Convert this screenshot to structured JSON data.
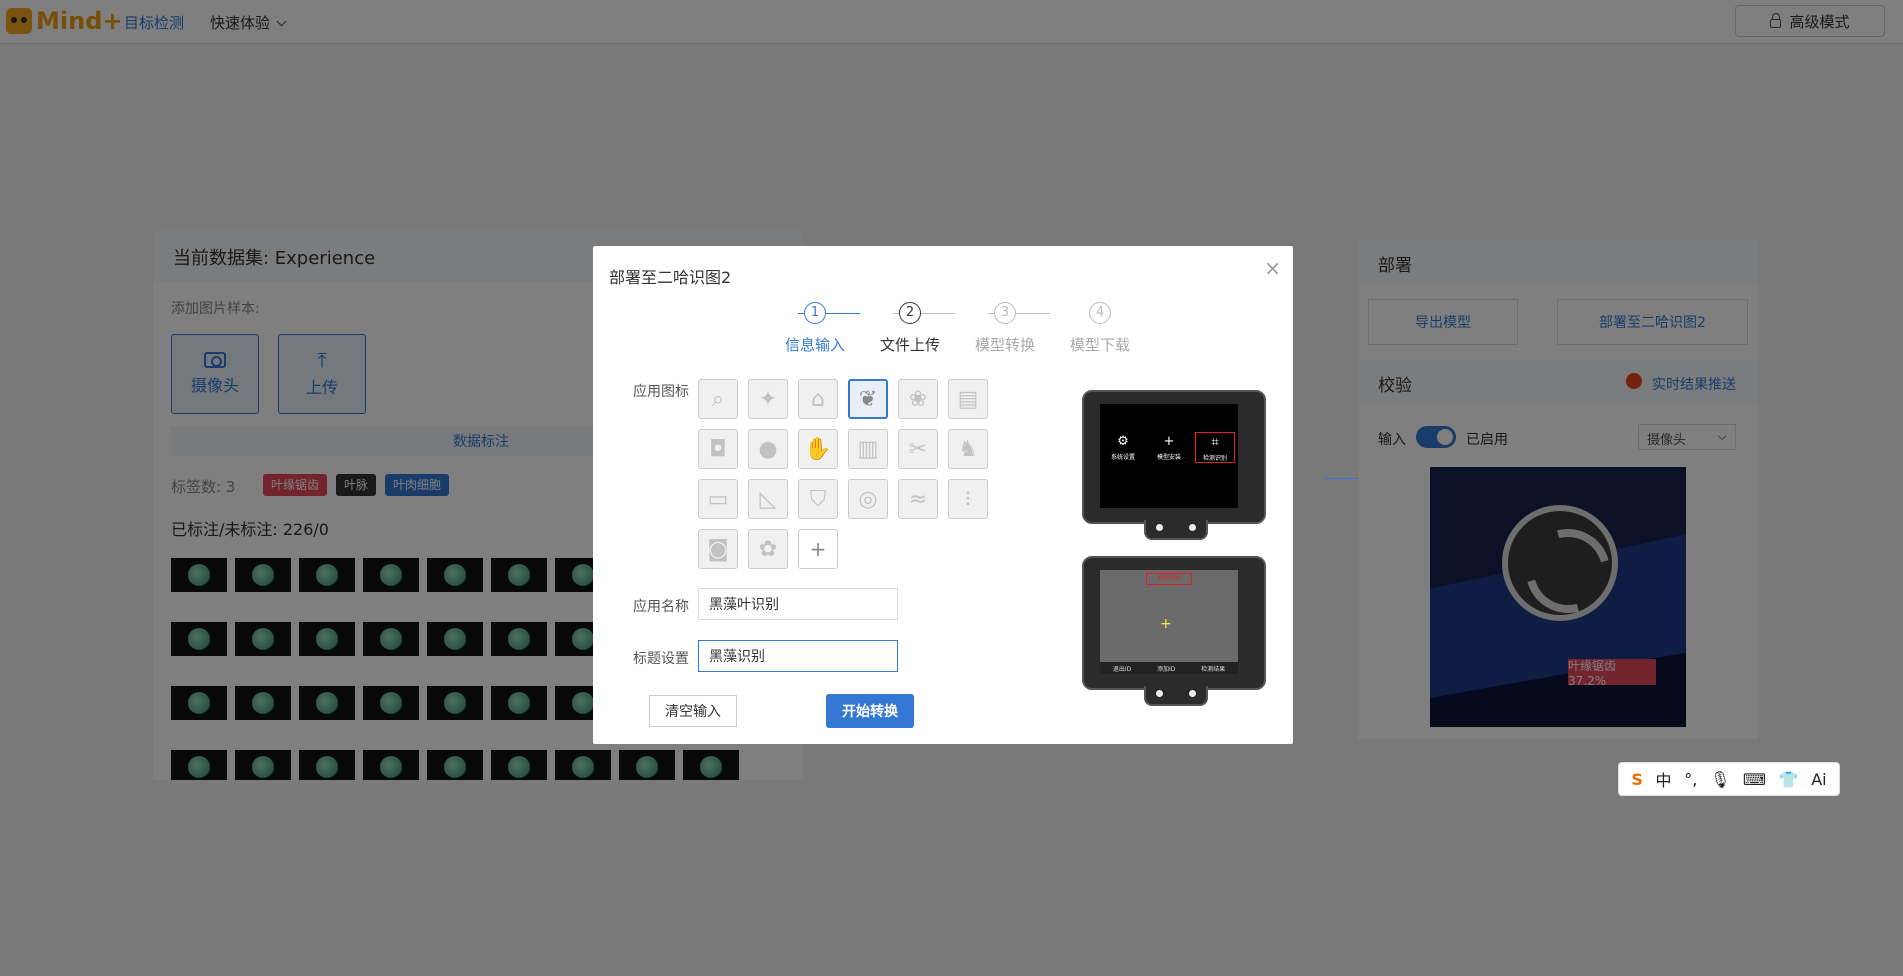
{
  "topbar": {
    "logo": "Mind+",
    "nav_detect": "目标检测",
    "nav_quick": "快速体验",
    "advanced_mode": "高级模式"
  },
  "left_panel": {
    "title": "当前数据集: Experience",
    "add_samples": "添加图片样本:",
    "camera_btn": "摄像头",
    "upload_btn": "上传",
    "annotate_bar": "数据标注",
    "label_count": "标签数: 3",
    "tags": [
      "叶缘锯齿",
      "叶脉",
      "叶肉细胞"
    ],
    "marked_status": "已标注/未标注: 226/0"
  },
  "right_panel": {
    "deploy_title": "部署",
    "export_btn": "导出模型",
    "deploy_btn": "部署至二哈识图2",
    "verify_title": "校验",
    "live_push": "实时结果推送",
    "input_label": "输入",
    "enabled_label": "已启用",
    "camera_select": "摄像头",
    "prediction_label": "叶缘锯齿 37.2%"
  },
  "modal": {
    "title": "部署至二哈识图2",
    "steps": [
      "信息输入",
      "文件上传",
      "模型转换",
      "模型下载"
    ],
    "step_numbers": [
      "1",
      "2",
      "3",
      "4"
    ],
    "app_icon_label": "应用图标",
    "app_name_label": "应用名称",
    "app_name_value": "黑藻叶识别",
    "title_label": "标题设置",
    "title_value": "黑藻识别",
    "clear_btn": "清空输入",
    "start_btn": "开始转换",
    "icons": [
      "search-icon",
      "puzzle-icon",
      "tag-icon",
      "plant-icon",
      "paw-icon",
      "cake-icon",
      "cup-icon",
      "apple-icon",
      "hand-icon",
      "trash-icon",
      "tools-icon",
      "rocking-horse-icon",
      "desk-icon",
      "ruler-icon",
      "shirt-icon",
      "washer-icon",
      "path-icon",
      "traffic-light-icon",
      "car-icon",
      "palette-icon",
      "add-icon"
    ],
    "device_menu": [
      "系统设置",
      "模型安装",
      "检测识别"
    ],
    "device_screen_title": "检测识别",
    "device_bottom": [
      "退出ID",
      "添加ID",
      "检测结果"
    ]
  },
  "ime": {
    "items": [
      "S",
      "中",
      "°,",
      "🎙",
      "⌨",
      "👕",
      "Ai"
    ]
  }
}
